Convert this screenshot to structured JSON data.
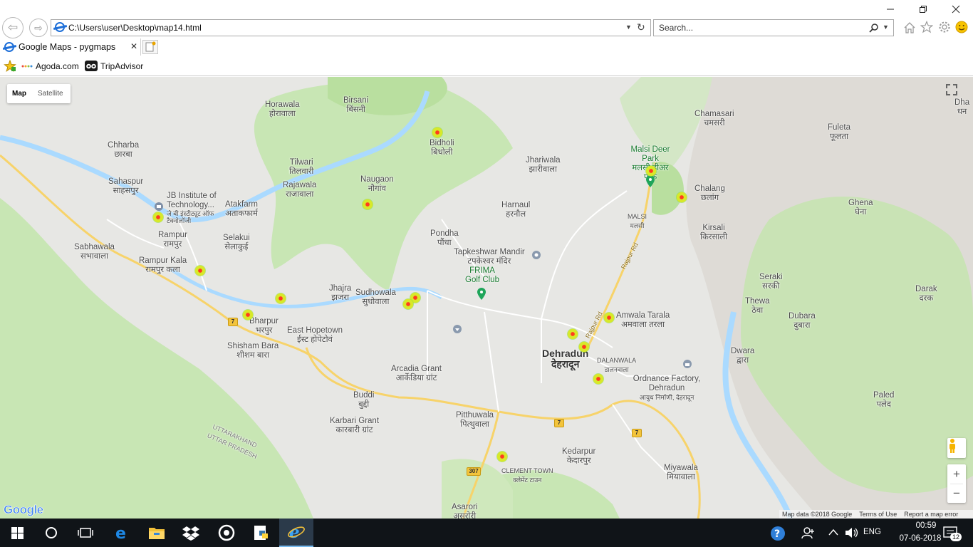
{
  "browser": {
    "address": "C:\\Users\\user\\Desktop\\map14.html",
    "search_placeholder": "Search...",
    "tab_title": "Google Maps - pygmaps",
    "tab_close": "✕",
    "favorites": [
      {
        "label": "Agoda.com"
      },
      {
        "label": "TripAdvisor"
      }
    ]
  },
  "map": {
    "map_type": {
      "map_label": "Map",
      "satellite_label": "Satellite"
    },
    "labels": [
      {
        "en": "Horawala",
        "hi": "होरावाला"
      },
      {
        "en": "Birsani",
        "hi": "बिंसनी"
      },
      {
        "en": "Chamasari",
        "hi": "चमसरी"
      },
      {
        "en": "Fuleta",
        "hi": "फूलता"
      },
      {
        "en": "Dha",
        "hi": "धन"
      },
      {
        "en": "Chharba",
        "hi": "छारबा"
      },
      {
        "en": "Bidholi",
        "hi": "बिधोली"
      },
      {
        "en": "Jhariwala",
        "hi": "झारीवाला"
      },
      {
        "en": "Malsi Deer Park",
        "hi": "मलसी डीअर पार्क"
      },
      {
        "en": "Tilwari",
        "hi": "तिलवारी"
      },
      {
        "en": "Naugaon",
        "hi": "नौगांव"
      },
      {
        "en": "Sahaspur",
        "hi": "साहसपुर"
      },
      {
        "en": "Rajawala",
        "hi": "राजावाला"
      },
      {
        "en": "Chalang",
        "hi": "छलांग"
      },
      {
        "en": "JB Institute of Technology...",
        "hi": "जे बी इंस्टीट्यूट ऑफ टैक्नोलॉजी"
      },
      {
        "en": "Atakfarm",
        "hi": "अताकफार्म"
      },
      {
        "en": "Harnaul",
        "hi": "हरनौल"
      },
      {
        "en": "Ghena",
        "hi": "घेना"
      },
      {
        "en": "MALSI",
        "hi": "मलसी"
      },
      {
        "en": "Kirsali",
        "hi": "किरसाली"
      },
      {
        "en": "Rampur",
        "hi": "रामपुर"
      },
      {
        "en": "Selakui",
        "hi": "सेलाकुई"
      },
      {
        "en": "Pondha",
        "hi": "पौंधा"
      },
      {
        "en": "Sabhawala",
        "hi": "सभावाला"
      },
      {
        "en": "Tapkeshwar Mandir",
        "hi": "टपकेश्वर मंदिर"
      },
      {
        "en": "Rampur Kala",
        "hi": "रामपुर कला"
      },
      {
        "en": "FRIMA Golf Club",
        "hi": ""
      },
      {
        "en": "Seraki",
        "hi": "सरकी"
      },
      {
        "en": "Darak",
        "hi": "दरक"
      },
      {
        "en": "Jhajra",
        "hi": "झजरा"
      },
      {
        "en": "Sudhowala",
        "hi": "सुधोवाला"
      },
      {
        "en": "Thewa",
        "hi": "ठेवा"
      },
      {
        "en": "Amwala Tarala",
        "hi": "अमवाला तरला"
      },
      {
        "en": "Dubara",
        "hi": "दुबारा"
      },
      {
        "en": "Bharpur",
        "hi": "भरपुर"
      },
      {
        "en": "East Hopetown",
        "hi": "ईस्ट होपेटोवं"
      },
      {
        "en": "Shisham Bara",
        "hi": "शीशम बारा"
      },
      {
        "en": "Dehradun",
        "hi": "देहरादून"
      },
      {
        "en": "DALANWALA",
        "hi": "डालनवाला"
      },
      {
        "en": "Dwara",
        "hi": "द्वारा"
      },
      {
        "en": "Arcadia Grant",
        "hi": "आर्केडिया ग्रांट"
      },
      {
        "en": "Ordnance Factory, Dehradun",
        "hi": "आयुध निर्माणी, देहरादून"
      },
      {
        "en": "Buddi",
        "hi": "बुद्दी"
      },
      {
        "en": "Paled",
        "hi": "पलेद"
      },
      {
        "en": "Pitthuwala",
        "hi": "पित्थुवाला"
      },
      {
        "en": "Karbari Grant",
        "hi": "कारबारी ग्रांट"
      },
      {
        "en": "Kedarpur",
        "hi": "केदारपुर"
      },
      {
        "en": "UTTARAKHAND",
        "hi": ""
      },
      {
        "en": "UTTAR PRADESH",
        "hi": ""
      },
      {
        "en": "CLEMENT TOWN",
        "hi": "क्लेमेंट टाउन"
      },
      {
        "en": "Miyawala",
        "hi": "मियावाला"
      },
      {
        "en": "Asarori",
        "hi": "असरोरी"
      },
      {
        "en": "Rajpur Rd",
        "hi": ""
      }
    ],
    "shields": [
      "7",
      "7",
      "7",
      "307"
    ],
    "google_logo": "Google",
    "attribution": {
      "data": "Map data ©2018 Google",
      "terms": "Terms of Use",
      "report": "Report a map error"
    },
    "zoom_in": "+",
    "zoom_out": "−"
  },
  "taskbar": {
    "language": "ENG",
    "time": "00:59",
    "date": "07-06-2018",
    "notifications": "12"
  },
  "colors": {
    "park": "#c8e6b4",
    "water": "#aadaff",
    "road_major": "#f7d36a",
    "marker_center": "#ff3b1f",
    "marker_ring": "#d8e82a",
    "taskbar": "#101418"
  }
}
